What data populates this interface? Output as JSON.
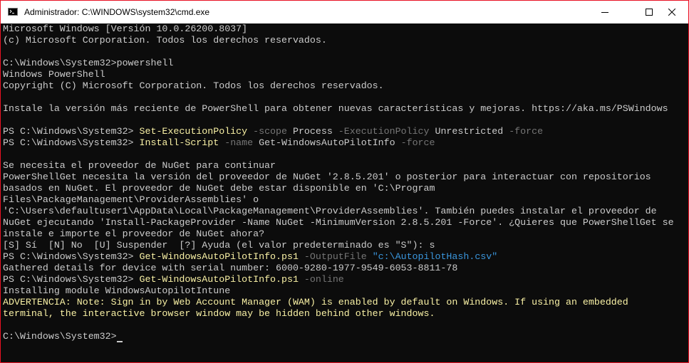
{
  "window": {
    "title": "Administrador: C:\\WINDOWS\\system32\\cmd.exe",
    "border_color": "#e81123"
  },
  "terminal": {
    "colors": {
      "background": "#0c0c0c",
      "foreground": "#cccccc",
      "command": "#f9f1a5",
      "parameter": "#767676",
      "string": "#3a96dd",
      "warning": "#f9f1a5"
    },
    "lines": [
      [
        {
          "t": "Microsoft Windows [Versión 10.0.26200.8037]"
        }
      ],
      [
        {
          "t": "(c) Microsoft Corporation. Todos los derechos reservados."
        }
      ],
      [],
      [
        {
          "t": "C:\\Windows\\System32>powershell"
        }
      ],
      [
        {
          "t": "Windows PowerShell"
        }
      ],
      [
        {
          "t": "Copyright (C) Microsoft Corporation. Todos los derechos reservados."
        }
      ],
      [],
      [
        {
          "t": "Instale la versión más reciente de PowerShell para obtener nuevas características y mejoras. https://aka.ms/PSWindows"
        }
      ],
      [],
      [
        {
          "t": "PS C:\\Windows\\System32> "
        },
        {
          "t": "Set-ExecutionPolicy",
          "c": "cmd"
        },
        {
          "t": " -scope",
          "c": "param"
        },
        {
          "t": " Process"
        },
        {
          "t": " -ExecutionPolicy",
          "c": "param"
        },
        {
          "t": " Unrestricted"
        },
        {
          "t": " -force",
          "c": "param"
        }
      ],
      [
        {
          "t": "PS C:\\Windows\\System32> "
        },
        {
          "t": "Install-Script",
          "c": "cmd"
        },
        {
          "t": " -name",
          "c": "param"
        },
        {
          "t": " Get-WindowsAutoPilotInfo"
        },
        {
          "t": " -force",
          "c": "param"
        }
      ],
      [],
      [
        {
          "t": "Se necesita el proveedor de NuGet para continuar"
        }
      ],
      [
        {
          "t": "PowerShellGet necesita la versión del proveedor de NuGet '2.8.5.201' o posterior para interactuar con repositorios"
        }
      ],
      [
        {
          "t": "basados en NuGet. El proveedor de NuGet debe estar disponible en 'C:\\Program"
        }
      ],
      [
        {
          "t": "Files\\PackageManagement\\ProviderAssemblies' o"
        }
      ],
      [
        {
          "t": "'C:\\Users\\defaultuser1\\AppData\\Local\\PackageManagement\\ProviderAssemblies'. También puedes instalar el proveedor de"
        }
      ],
      [
        {
          "t": "NuGet ejecutando 'Install-PackageProvider -Name NuGet -MinimumVersion 2.8.5.201 -Force'. ¿Quieres que PowerShellGet se"
        }
      ],
      [
        {
          "t": "instale e importe el proveedor de NuGet ahora?"
        }
      ],
      [
        {
          "t": "[S] Sí  [N] No  [U] Suspender  [?] Ayuda (el valor predeterminado es \"S\"): s"
        }
      ],
      [
        {
          "t": "PS C:\\Windows\\System32> "
        },
        {
          "t": "Get-WindowsAutoPilotInfo.ps1",
          "c": "cmd"
        },
        {
          "t": " -OutputFile",
          "c": "param"
        },
        {
          "t": " \"c:\\AutopilotHash.csv\"",
          "c": "str"
        }
      ],
      [
        {
          "t": "Gathered details for device with serial number: 6000-9280-1977-9549-6053-8811-78"
        }
      ],
      [
        {
          "t": "PS C:\\Windows\\System32> "
        },
        {
          "t": "Get-WindowsAutoPilotInfo.ps1",
          "c": "cmd"
        },
        {
          "t": " -online",
          "c": "param"
        }
      ],
      [
        {
          "t": "Installing module WindowsAutopilotIntune"
        }
      ],
      [
        {
          "t": "ADVERTENCIA: Note: Sign in by Web Account Manager (WAM) is enabled by default on Windows. If using an embedded",
          "c": "warn"
        }
      ],
      [
        {
          "t": "terminal, the interactive browser window may be hidden behind other windows.",
          "c": "warn"
        }
      ],
      [],
      [
        {
          "t": "C:\\Windows\\System32>"
        }
      ]
    ]
  }
}
